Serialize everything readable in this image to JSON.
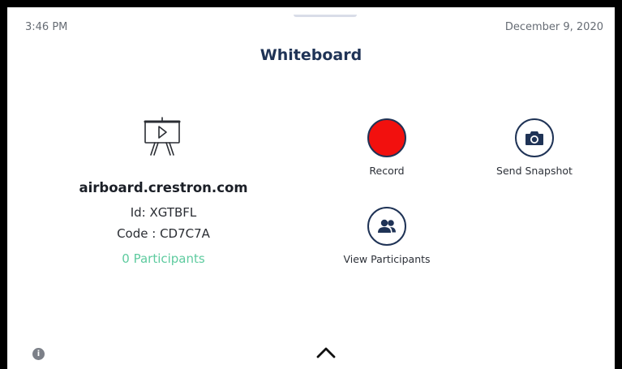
{
  "status_bar": {
    "time": "3:46 PM",
    "date": "December 9, 2020"
  },
  "header": {
    "title": "Whiteboard"
  },
  "whiteboard_info": {
    "icon": "easel-whiteboard-icon",
    "url": "airboard.crestron.com",
    "id_line": "Id:  XGTBFL",
    "code_line": "Code : CD7C7A",
    "participants": "0 Participants"
  },
  "actions": {
    "record": {
      "label": "Record",
      "icon": "record-icon",
      "color": "#f2100e"
    },
    "send_snapshot": {
      "label": "Send Snapshot",
      "icon": "camera-icon"
    },
    "view_participants": {
      "label": "View Participants",
      "icon": "people-icon"
    }
  },
  "footer": {
    "info_icon": "info-icon",
    "info_glyph": "i",
    "expand_icon": "chevron-up-icon"
  },
  "colors": {
    "accent": "#1f3356",
    "participants_green": "#5ecb9f",
    "record_red": "#f2100e"
  }
}
